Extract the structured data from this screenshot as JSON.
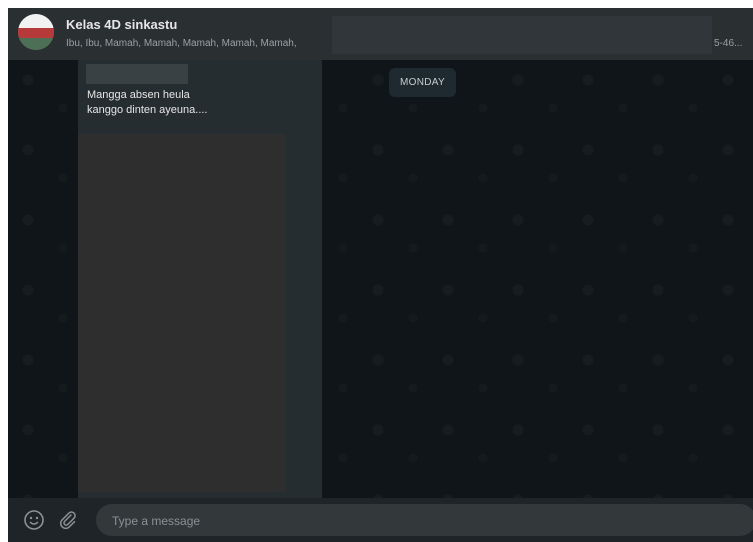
{
  "chat": {
    "title": "Kelas 4D sinkastu",
    "participants": "Ibu, Ibu, Mamah, Mamah, Mamah, Mamah, Mamah,",
    "participants_tail": "5-46..."
  },
  "conversation": {
    "day_label": "MONDAY",
    "messages": [
      {
        "text_line1": "Mangga absen heula",
        "text_line2": "kanggo dinten ayeuna...."
      }
    ]
  },
  "composer": {
    "placeholder": "Type a message",
    "emoji_icon": "emoji-icon",
    "attach_icon": "paperclip-icon"
  },
  "colors": {
    "header_bg": "#2a2f32",
    "chat_bg": "#0f1518",
    "bubble_bg": "#262d31",
    "composer_bg": "#1e2428"
  }
}
